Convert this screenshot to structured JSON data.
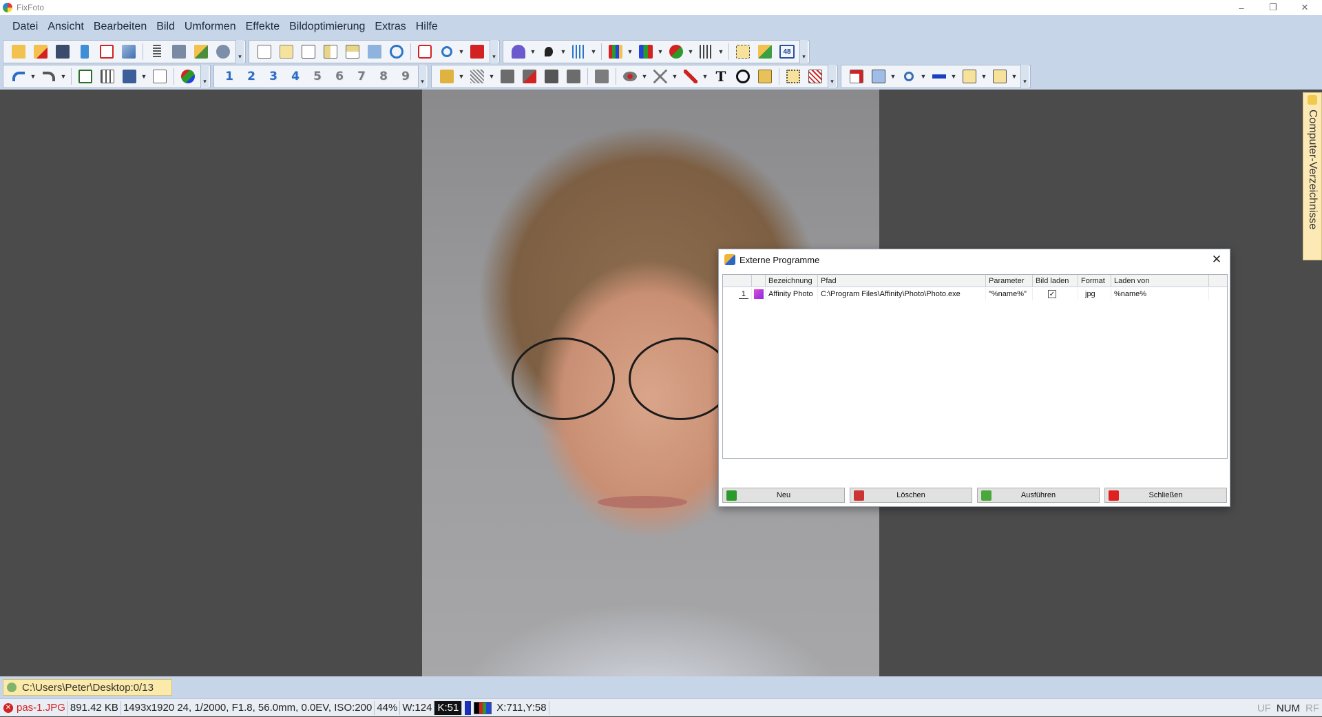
{
  "window": {
    "title": "FixFoto",
    "controls": [
      "–",
      "❐",
      "✕"
    ]
  },
  "menu": [
    "Datei",
    "Ansicht",
    "Bearbeiten",
    "Bild",
    "Umformen",
    "Effekte",
    "Bildoptimierung",
    "Extras",
    "Hilfe"
  ],
  "toolbar": {
    "number_buttons": [
      "1",
      "2",
      "3",
      "4",
      "5",
      "6",
      "7",
      "8",
      "9"
    ],
    "size_badge": "48",
    "text_tool": "T"
  },
  "side_panel": {
    "label": "Computer-Verzeichnisse"
  },
  "pathbar": {
    "path": "C:\\Users\\Peter\\Desktop:0/13"
  },
  "statusbar": {
    "filename": "pas-1.JPG",
    "filesize": "891.42 KB",
    "exif": "1493x1920 24, 1/2000, F1.8, 56.0mm, 0.0EV, ISO:200",
    "zoom": "44%",
    "width_indicator": "W:124",
    "k_indicator": "K:51",
    "coords": "X:711,Y:58",
    "right_uf": "UF",
    "right_num": "NUM",
    "right_rf": "RF"
  },
  "dialog": {
    "title": "Externe Programme",
    "columns": [
      "",
      "",
      "Bezeichnung",
      "Pfad",
      "Parameter",
      "Bild laden",
      "Format",
      "Laden von"
    ],
    "rows": [
      {
        "num": "1",
        "name": "Affinity Photo",
        "path": "C:\\Program Files\\Affinity\\Photo\\Photo.exe",
        "parameter": "\"%name%\"",
        "load_image": "✓",
        "format": "jpg",
        "load_from": "%name%"
      }
    ],
    "buttons": {
      "new": "Neu",
      "delete": "Löschen",
      "run": "Ausführen",
      "close": "Schließen"
    }
  },
  "colors": {
    "chrome": "#c7d5e8",
    "workspace": "#4b4b4b",
    "path_highlight": "#fbeaa9",
    "error_red": "#d32222"
  }
}
